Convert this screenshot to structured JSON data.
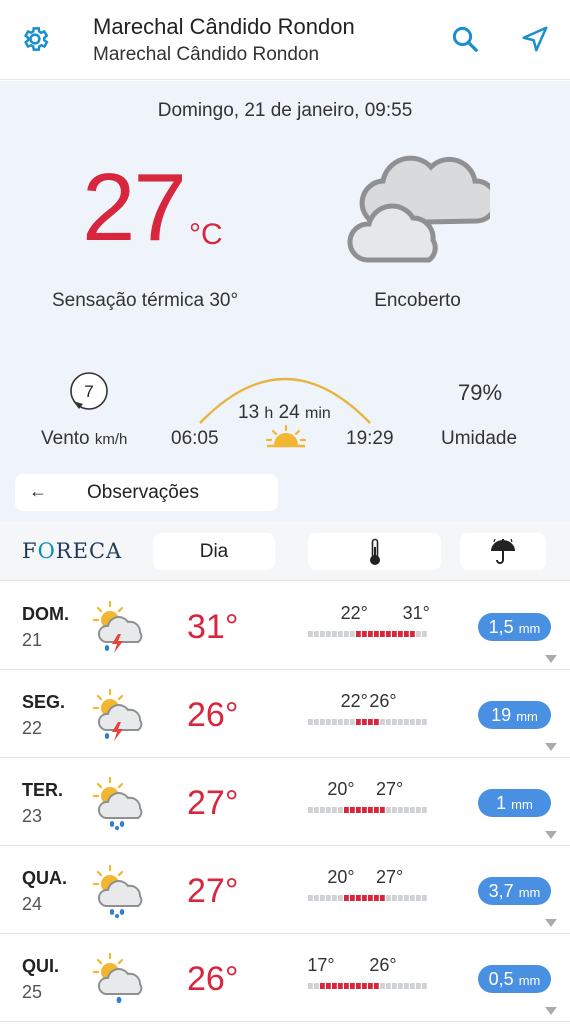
{
  "header": {
    "title": "Marechal Cândido Rondon",
    "subtitle": "Marechal Cândido Rondon",
    "icons": [
      "gear-icon",
      "search-icon",
      "location-arrow-icon"
    ]
  },
  "current": {
    "datetime": "Domingo, 21 de janeiro, 09:55",
    "temperature": "27",
    "unit": "°C",
    "feels_like": "Sensação térmica 30°",
    "condition": "Encoberto",
    "condition_icon": "overcast-cloud-icon",
    "wind_speed": "7",
    "wind_label": "Vento",
    "wind_unit": "km/h",
    "day_length_h": "13",
    "h_label": "h",
    "day_length_min": "24",
    "min_label": "min",
    "sunrise": "06:05",
    "sunset": "19:29",
    "humidity": "79%",
    "humidity_label": "Umidade"
  },
  "observations_button": {
    "label": "Observações"
  },
  "toolbar": {
    "brand_pre": "F",
    "brand_o": "O",
    "brand_post": "RECA",
    "day_label": "Dia",
    "icons": [
      "thermometer-icon",
      "umbrella-icon"
    ]
  },
  "colors": {
    "temp_red": "#d7263d",
    "rain_blue": "#4a90e2",
    "hero_bg": "#eef4fa",
    "accent_blue": "#1a8fd0"
  },
  "forecast": [
    {
      "day": "DOM.",
      "date": "21",
      "icon": "thunderstorm-icon",
      "max": "31°",
      "low": "22°",
      "high": "31°",
      "rain": "1,5",
      "rain_unit": "mm"
    },
    {
      "day": "SEG.",
      "date": "22",
      "icon": "thunderstorm-icon",
      "max": "26°",
      "low": "22°",
      "high": "26°",
      "rain": "19",
      "rain_unit": "mm"
    },
    {
      "day": "TER.",
      "date": "23",
      "icon": "rain-showers-icon",
      "max": "27°",
      "low": "20°",
      "high": "27°",
      "rain": "1",
      "rain_unit": "mm"
    },
    {
      "day": "QUA.",
      "date": "24",
      "icon": "rain-showers-icon",
      "max": "27°",
      "low": "20°",
      "high": "27°",
      "rain": "3,7",
      "rain_unit": "mm"
    },
    {
      "day": "QUI.",
      "date": "25",
      "icon": "light-rain-icon",
      "max": "26°",
      "low": "17°",
      "high": "26°",
      "rain": "0,5",
      "rain_unit": "mm"
    }
  ]
}
